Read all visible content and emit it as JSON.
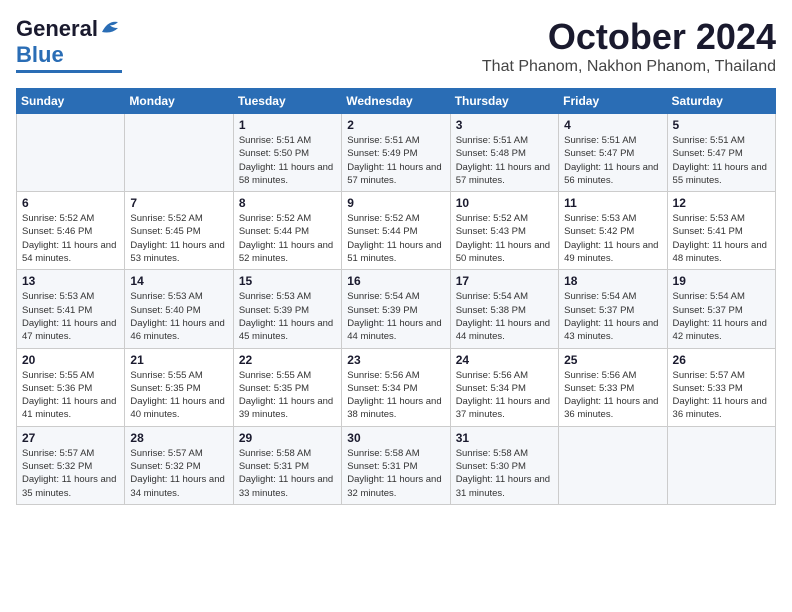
{
  "logo": {
    "text1": "General",
    "text2": "Blue"
  },
  "header": {
    "month": "October 2024",
    "location": "That Phanom, Nakhon Phanom, Thailand"
  },
  "weekdays": [
    "Sunday",
    "Monday",
    "Tuesday",
    "Wednesday",
    "Thursday",
    "Friday",
    "Saturday"
  ],
  "weeks": [
    [
      {
        "day": "",
        "info": ""
      },
      {
        "day": "",
        "info": ""
      },
      {
        "day": "1",
        "info": "Sunrise: 5:51 AM\nSunset: 5:50 PM\nDaylight: 11 hours and 58 minutes."
      },
      {
        "day": "2",
        "info": "Sunrise: 5:51 AM\nSunset: 5:49 PM\nDaylight: 11 hours and 57 minutes."
      },
      {
        "day": "3",
        "info": "Sunrise: 5:51 AM\nSunset: 5:48 PM\nDaylight: 11 hours and 57 minutes."
      },
      {
        "day": "4",
        "info": "Sunrise: 5:51 AM\nSunset: 5:47 PM\nDaylight: 11 hours and 56 minutes."
      },
      {
        "day": "5",
        "info": "Sunrise: 5:51 AM\nSunset: 5:47 PM\nDaylight: 11 hours and 55 minutes."
      }
    ],
    [
      {
        "day": "6",
        "info": "Sunrise: 5:52 AM\nSunset: 5:46 PM\nDaylight: 11 hours and 54 minutes."
      },
      {
        "day": "7",
        "info": "Sunrise: 5:52 AM\nSunset: 5:45 PM\nDaylight: 11 hours and 53 minutes."
      },
      {
        "day": "8",
        "info": "Sunrise: 5:52 AM\nSunset: 5:44 PM\nDaylight: 11 hours and 52 minutes."
      },
      {
        "day": "9",
        "info": "Sunrise: 5:52 AM\nSunset: 5:44 PM\nDaylight: 11 hours and 51 minutes."
      },
      {
        "day": "10",
        "info": "Sunrise: 5:52 AM\nSunset: 5:43 PM\nDaylight: 11 hours and 50 minutes."
      },
      {
        "day": "11",
        "info": "Sunrise: 5:53 AM\nSunset: 5:42 PM\nDaylight: 11 hours and 49 minutes."
      },
      {
        "day": "12",
        "info": "Sunrise: 5:53 AM\nSunset: 5:41 PM\nDaylight: 11 hours and 48 minutes."
      }
    ],
    [
      {
        "day": "13",
        "info": "Sunrise: 5:53 AM\nSunset: 5:41 PM\nDaylight: 11 hours and 47 minutes."
      },
      {
        "day": "14",
        "info": "Sunrise: 5:53 AM\nSunset: 5:40 PM\nDaylight: 11 hours and 46 minutes."
      },
      {
        "day": "15",
        "info": "Sunrise: 5:53 AM\nSunset: 5:39 PM\nDaylight: 11 hours and 45 minutes."
      },
      {
        "day": "16",
        "info": "Sunrise: 5:54 AM\nSunset: 5:39 PM\nDaylight: 11 hours and 44 minutes."
      },
      {
        "day": "17",
        "info": "Sunrise: 5:54 AM\nSunset: 5:38 PM\nDaylight: 11 hours and 44 minutes."
      },
      {
        "day": "18",
        "info": "Sunrise: 5:54 AM\nSunset: 5:37 PM\nDaylight: 11 hours and 43 minutes."
      },
      {
        "day": "19",
        "info": "Sunrise: 5:54 AM\nSunset: 5:37 PM\nDaylight: 11 hours and 42 minutes."
      }
    ],
    [
      {
        "day": "20",
        "info": "Sunrise: 5:55 AM\nSunset: 5:36 PM\nDaylight: 11 hours and 41 minutes."
      },
      {
        "day": "21",
        "info": "Sunrise: 5:55 AM\nSunset: 5:35 PM\nDaylight: 11 hours and 40 minutes."
      },
      {
        "day": "22",
        "info": "Sunrise: 5:55 AM\nSunset: 5:35 PM\nDaylight: 11 hours and 39 minutes."
      },
      {
        "day": "23",
        "info": "Sunrise: 5:56 AM\nSunset: 5:34 PM\nDaylight: 11 hours and 38 minutes."
      },
      {
        "day": "24",
        "info": "Sunrise: 5:56 AM\nSunset: 5:34 PM\nDaylight: 11 hours and 37 minutes."
      },
      {
        "day": "25",
        "info": "Sunrise: 5:56 AM\nSunset: 5:33 PM\nDaylight: 11 hours and 36 minutes."
      },
      {
        "day": "26",
        "info": "Sunrise: 5:57 AM\nSunset: 5:33 PM\nDaylight: 11 hours and 36 minutes."
      }
    ],
    [
      {
        "day": "27",
        "info": "Sunrise: 5:57 AM\nSunset: 5:32 PM\nDaylight: 11 hours and 35 minutes."
      },
      {
        "day": "28",
        "info": "Sunrise: 5:57 AM\nSunset: 5:32 PM\nDaylight: 11 hours and 34 minutes."
      },
      {
        "day": "29",
        "info": "Sunrise: 5:58 AM\nSunset: 5:31 PM\nDaylight: 11 hours and 33 minutes."
      },
      {
        "day": "30",
        "info": "Sunrise: 5:58 AM\nSunset: 5:31 PM\nDaylight: 11 hours and 32 minutes."
      },
      {
        "day": "31",
        "info": "Sunrise: 5:58 AM\nSunset: 5:30 PM\nDaylight: 11 hours and 31 minutes."
      },
      {
        "day": "",
        "info": ""
      },
      {
        "day": "",
        "info": ""
      }
    ]
  ]
}
